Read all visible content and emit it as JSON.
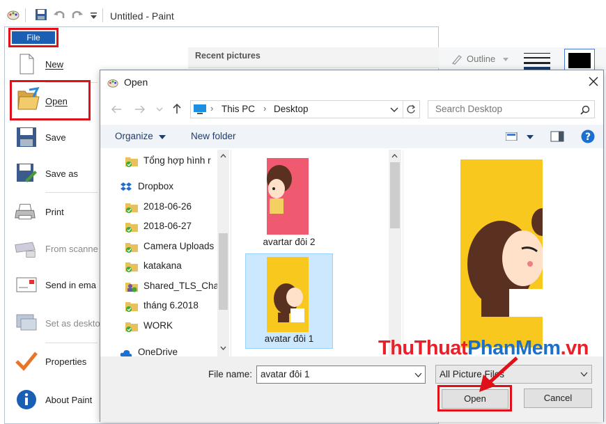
{
  "window": {
    "title": "Untitled - Paint"
  },
  "file_tab": {
    "label": "File"
  },
  "file_menu": {
    "items": [
      {
        "label": "New"
      },
      {
        "label": "Open"
      },
      {
        "label": "Save"
      },
      {
        "label": "Save as"
      },
      {
        "label": "Print"
      },
      {
        "label": "From scanne"
      },
      {
        "label": "Send in ema"
      },
      {
        "label": "Set as deskto"
      },
      {
        "label": "Properties"
      },
      {
        "label": "About Paint"
      }
    ],
    "recent_header": "Recent pictures"
  },
  "ribbon": {
    "outline_label": "Outline"
  },
  "dialog": {
    "title": "Open",
    "breadcrumb": [
      "This PC",
      "Desktop"
    ],
    "search_placeholder": "Search Desktop",
    "toolbar": {
      "organize": "Organize",
      "new_folder": "New folder"
    },
    "nav_items": [
      {
        "label": "Tổng hợp hình r",
        "icon": "folder-synced-icon"
      },
      {
        "label": "Dropbox",
        "icon": "dropbox-icon"
      },
      {
        "label": "2018-06-26",
        "icon": "folder-synced-icon"
      },
      {
        "label": "2018-06-27",
        "icon": "folder-synced-icon"
      },
      {
        "label": "Camera Uploads",
        "icon": "folder-synced-icon"
      },
      {
        "label": "katakana",
        "icon": "folder-synced-icon"
      },
      {
        "label": "Shared_TLS_Cha",
        "icon": "shared-folder-icon"
      },
      {
        "label": "tháng 6.2018",
        "icon": "folder-synced-icon"
      },
      {
        "label": "WORK",
        "icon": "folder-synced-icon"
      },
      {
        "label": "OneDrive",
        "icon": "onedrive-icon"
      }
    ],
    "files": [
      {
        "name": "avartar đôi 2",
        "thumb_color": "#f05a70"
      },
      {
        "name": "avatar đôi 1",
        "thumb_color": "#f9c81e",
        "selected": true
      }
    ],
    "file_name_label": "File name:",
    "file_name_value": "avatar đôi 1",
    "file_type_value": "All Picture Files",
    "open_button": "Open",
    "cancel_button": "Cancel"
  },
  "watermark": {
    "part1": "ThuThuat",
    "part2": "PhanMem",
    "part3": ".vn"
  },
  "colors": {
    "highlight_red": "#e0101a",
    "accent_blue": "#1a5fb4",
    "selection": "#cce8ff"
  }
}
